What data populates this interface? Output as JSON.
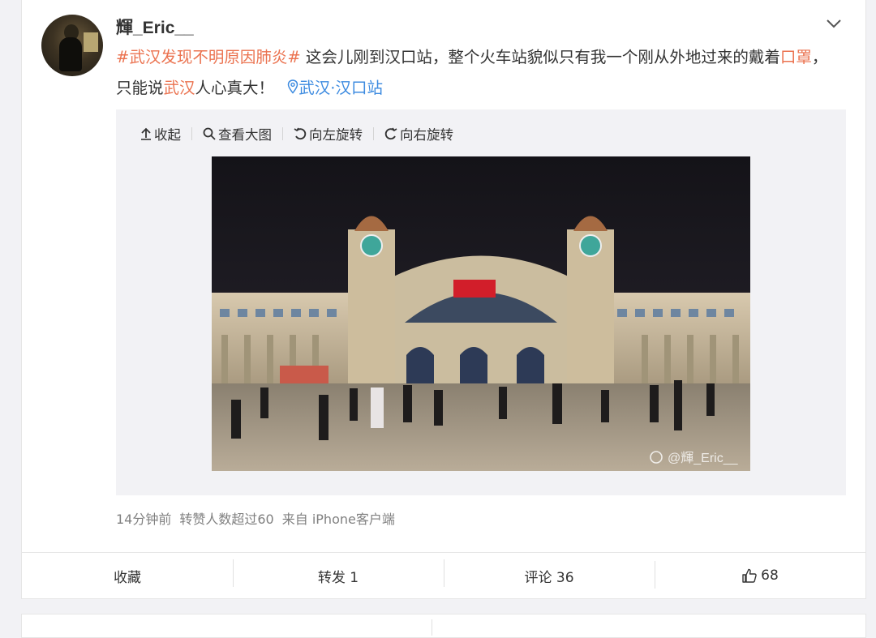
{
  "post": {
    "username": "輝_Eric__",
    "text": {
      "tag": "#武汉发现不明原因肺炎#",
      "part1": " 这会儿刚到汉口站，整个火车站貌似只有我一个刚从外地过来的戴着",
      "kw1": "口罩",
      "part2": "，只能说",
      "kw2": "武汉",
      "part3": "人心真大！",
      "location": "武汉·汉口站"
    },
    "media_tools": {
      "collapse": "收起",
      "view_large": "查看大图",
      "rotate_left": "向左旋转",
      "rotate_right": "向右旋转"
    },
    "watermark": "@輝_Eric__",
    "meta": {
      "time": "14分钟前",
      "reposts_note": "转赞人数超过60",
      "source": "来自 iPhone客户端"
    }
  },
  "actions": {
    "favorite": "收藏",
    "repost": "转发 1",
    "comment": "评论 36",
    "likes": "68"
  },
  "icons": {
    "chevron": "chevron-down-icon",
    "location": "location-pin-icon",
    "like": "thumbs-up-icon"
  },
  "colors": {
    "link": "#eb7350",
    "location": "#3d8be0"
  }
}
